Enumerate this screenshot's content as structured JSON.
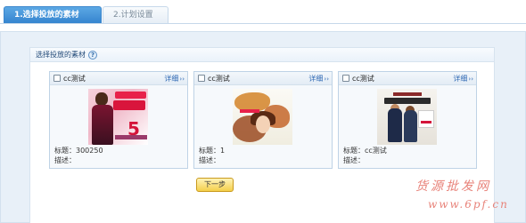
{
  "tabs": [
    {
      "label": "1.选择投放的素材",
      "active": true
    },
    {
      "label": "2.计划设置",
      "active": false
    }
  ],
  "section": {
    "title": "选择投放的素材",
    "help_icon": "question-icon"
  },
  "cards": [
    {
      "name": "cc测试",
      "detail_label": "详细",
      "title_label": "标题：",
      "title_value": "300250",
      "desc_label": "描述：",
      "desc_value": ""
    },
    {
      "name": "cc测试",
      "detail_label": "详细",
      "title_label": "标题：",
      "title_value": "1",
      "desc_label": "描述：",
      "desc_value": ""
    },
    {
      "name": "cc测试",
      "detail_label": "详细",
      "title_label": "标题：",
      "title_value": "cc测试",
      "desc_label": "描述：",
      "desc_value": ""
    }
  ],
  "next_button": {
    "label": "下一步"
  },
  "watermark": {
    "line1": "货源批发网",
    "line2": "www.6pf.cn"
  },
  "colors": {
    "tab_active": "#3584cf",
    "panel_bg": "#e8f0f8",
    "link": "#2d67b3",
    "button": "#f4cf4a",
    "watermark": "#e8837a"
  }
}
